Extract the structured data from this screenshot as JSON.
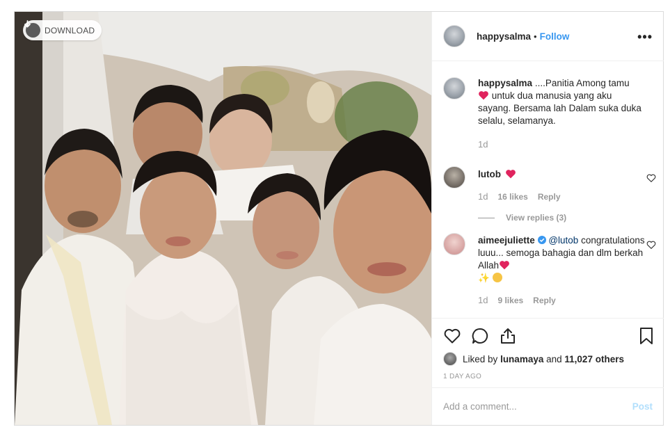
{
  "photo": {
    "download_label": "DOWNLOAD",
    "download_icon": "download-icon"
  },
  "post": {
    "username": "happysalma",
    "separator": "•",
    "follow_label": "Follow",
    "more_icon": "more-options-icon"
  },
  "caption": {
    "username": "happysalma",
    "text_before": "....Panitia Among tamu",
    "text_after": "untuk dua manusia yang aku sayang. Bersama lah Dalam suka duka selalu, selamanya.",
    "age": "1d"
  },
  "comments": [
    {
      "username": "lutob",
      "text": "",
      "age": "1d",
      "likes": "16 likes",
      "reply_label": "Reply",
      "view_replies": "View replies (3)"
    },
    {
      "username": "aimeejuliette",
      "verified": true,
      "mention": "@lutob",
      "text": "congratulations luuu... semoga bahagia dan dlm berkah Allah",
      "age": "1d",
      "likes": "9 likes",
      "reply_label": "Reply"
    }
  ],
  "actions": {
    "like_icon": "heart-icon",
    "comment_icon": "comment-icon",
    "share_icon": "share-icon",
    "save_icon": "bookmark-icon"
  },
  "likes_summary": {
    "prefix": "Liked by",
    "user": "lunamaya",
    "middle": "and",
    "others": "11,027 others"
  },
  "timestamp": "1 DAY AGO",
  "add_comment": {
    "placeholder": "Add a comment...",
    "post_label": "Post"
  },
  "colors": {
    "accent": "#3897f0",
    "heart": "#ed4956",
    "post_disabled": "#b2dffc",
    "verified": "#3897f0"
  }
}
